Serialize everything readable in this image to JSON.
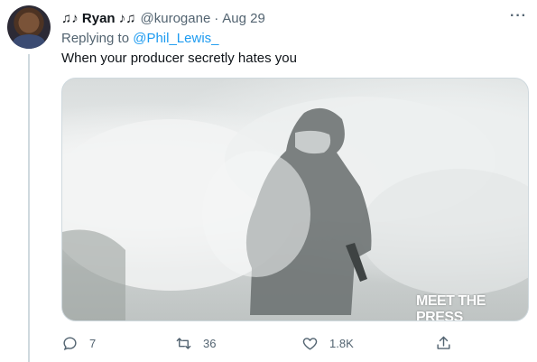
{
  "tweet": {
    "display_name": "♫♪ Ryan ♪♫",
    "handle": "@kurogane",
    "separator": "·",
    "date": "Aug 29",
    "more_label": "···",
    "replying_prefix": "Replying to",
    "replying_to": "@Phil_Lewis_",
    "text": "When your producer secretly hates you"
  },
  "media": {
    "watermark": "MEET THE PRESS"
  },
  "actions": {
    "reply_count": "7",
    "retweet_count": "36",
    "like_count": "1.8K"
  },
  "colors": {
    "link": "#1d9bf0",
    "muted": "#536471",
    "text": "#0f1419",
    "border": "#cfd9de"
  }
}
